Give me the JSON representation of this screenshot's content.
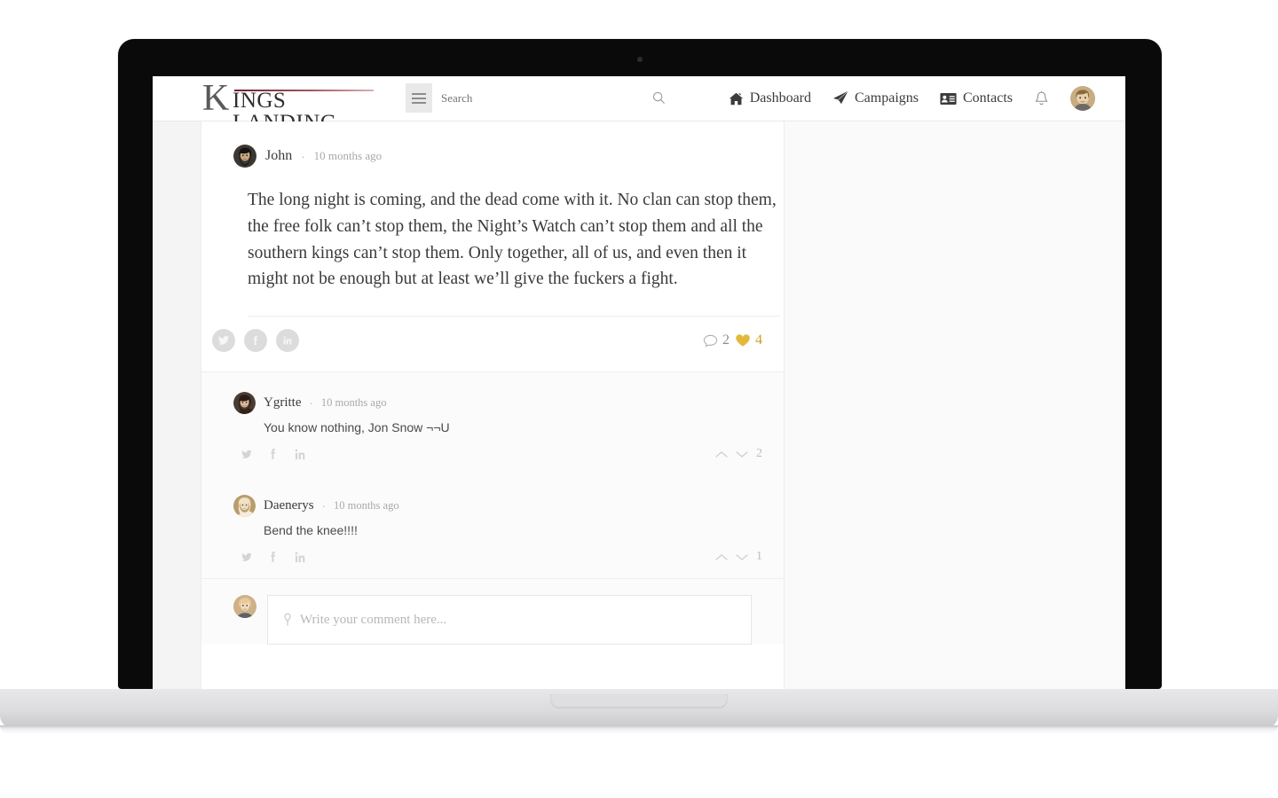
{
  "header": {
    "logo": {
      "initial": "K",
      "word": "INGS LANDING"
    },
    "search": {
      "placeholder": "Search",
      "value": "",
      "menu_icon": "hamburger-icon",
      "search_icon": "search-icon"
    },
    "nav": [
      {
        "label": "Dashboard",
        "icon": "home-icon"
      },
      {
        "label": "Campaigns",
        "icon": "paper-plane-icon"
      },
      {
        "label": "Contacts",
        "icon": "contact-card-icon"
      }
    ],
    "bell_icon": "bell-icon",
    "avatar": "user-avatar"
  },
  "post": {
    "author": "John",
    "separator": "·",
    "time": "10 months ago",
    "body": "The long night is coming, and the dead come with it. No clan can stop them, the free folk can’t stop them, the Night’s Watch can’t stop them and all the southern kings can’t stop them. Only together, all of us, and even then it might not be enough but at least we’ll give the fuckers a fight.",
    "share": [
      {
        "name": "twitter-share-icon"
      },
      {
        "name": "facebook-share-icon"
      },
      {
        "name": "linkedin-share-icon"
      }
    ],
    "comment_count": "2",
    "like_count": "4",
    "like_color": "#e2b93b"
  },
  "comments": [
    {
      "author": "Ygritte",
      "separator": "·",
      "time": "10 months ago",
      "text": "You know nothing, Jon Snow ¬¬U",
      "vote_count": "2"
    },
    {
      "author": "Daenerys",
      "separator": "·",
      "time": "10 months ago",
      "text": "Bend the knee!!!!",
      "vote_count": "1"
    }
  ],
  "composer": {
    "placeholder": "Write your comment here...",
    "value": "",
    "icon": "quill-icon",
    "avatar": "current-user-avatar"
  }
}
